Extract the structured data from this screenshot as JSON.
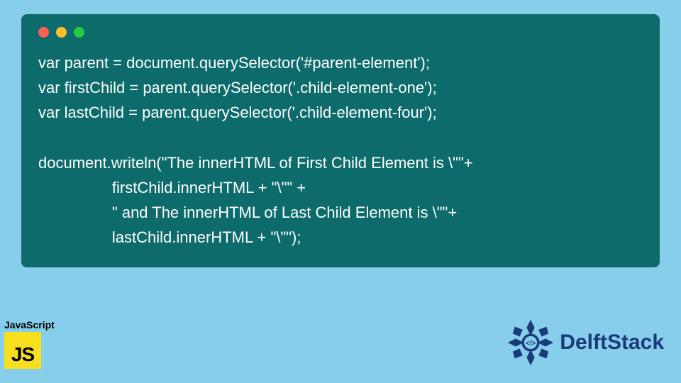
{
  "code": {
    "line1": "var parent = document.querySelector('#parent-element');",
    "line2": "var firstChild = parent.querySelector('.child-element-one');",
    "line3": "var lastChild = parent.querySelector('.child-element-four');",
    "line4": "",
    "line5": "document.writeln(\"The innerHTML of First Child Element is \\\"\"+",
    "line6": "                 firstChild.innerHTML + \"\\\"\" +",
    "line7": "                 \" and The innerHTML of Last Child Element is \\\"\"+",
    "line8": "                 lastChild.innerHTML + \"\\\"\");"
  },
  "badges": {
    "js_label": "JavaScript",
    "js_text": "JS",
    "brand": "DelftStack"
  },
  "colors": {
    "page_bg": "#87ceeb",
    "window_bg": "#0d6b6b",
    "code_text": "#ffffff",
    "js_bg": "#f7df1e",
    "brand_color": "#1b3a7a"
  }
}
